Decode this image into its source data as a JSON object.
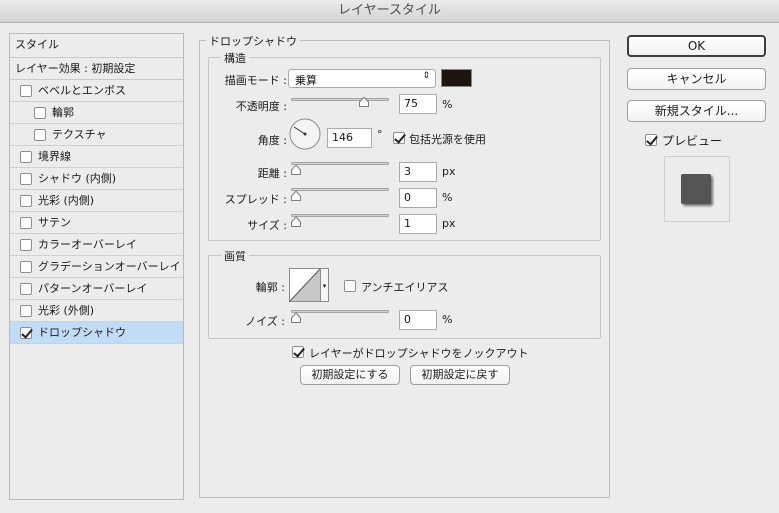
{
  "window": {
    "title": "レイヤースタイル"
  },
  "sidebar": {
    "header": "スタイル",
    "effects_header": "レイヤー効果 : 初期設定",
    "items": [
      {
        "label": "ベベルとエンボス",
        "checked": false
      },
      {
        "label": "輪郭",
        "checked": false
      },
      {
        "label": "テクスチャ",
        "checked": false
      },
      {
        "label": "境界線",
        "checked": false
      },
      {
        "label": "シャドウ (内側)",
        "checked": false
      },
      {
        "label": "光彩 (内側)",
        "checked": false
      },
      {
        "label": "サテン",
        "checked": false
      },
      {
        "label": "カラーオーバーレイ",
        "checked": false
      },
      {
        "label": "グラデーションオーバーレイ",
        "checked": false
      },
      {
        "label": "パターンオーバーレイ",
        "checked": false
      },
      {
        "label": "光彩 (外側)",
        "checked": false
      },
      {
        "label": "ドロップシャドウ",
        "checked": true
      }
    ]
  },
  "panel": {
    "title": "ドロップシャドウ",
    "structure": {
      "title": "構造",
      "blend_mode_label": "描画モード :",
      "blend_mode_value": "乗算",
      "color": "#1b1411",
      "opacity_label": "不透明度 :",
      "opacity_value": "75",
      "opacity_unit": "%",
      "angle_label": "角度 :",
      "angle_value": "146",
      "angle_unit": "°",
      "global_light_label": "包括光源を使用",
      "global_light_checked": true,
      "distance_label": "距離 :",
      "distance_value": "3",
      "distance_unit": "px",
      "spread_label": "スプレッド :",
      "spread_value": "0",
      "spread_unit": "%",
      "size_label": "サイズ :",
      "size_value": "1",
      "size_unit": "px"
    },
    "quality": {
      "title": "画質",
      "contour_label": "輪郭 :",
      "antialias_label": "アンチエイリアス",
      "antialias_checked": false,
      "noise_label": "ノイズ :",
      "noise_value": "0",
      "noise_unit": "%"
    },
    "knockout_label": "レイヤーがドロップシャドウをノックアウト",
    "knockout_checked": true,
    "make_default_label": "初期設定にする",
    "reset_default_label": "初期設定に戻す"
  },
  "buttons": {
    "ok": "OK",
    "cancel": "キャンセル",
    "new_style": "新規スタイル...",
    "preview_label": "プレビュー",
    "preview_checked": true
  },
  "colors": {
    "selected_row": "#c1dcf7",
    "ok_border": "#3d3d3d",
    "swatch_preview": "#555555"
  }
}
